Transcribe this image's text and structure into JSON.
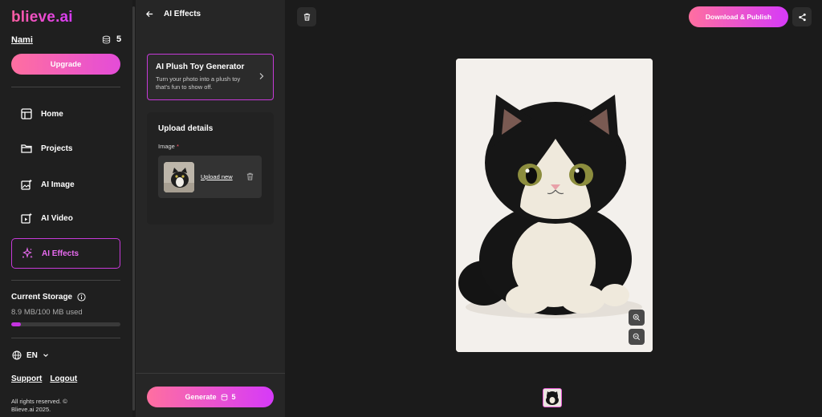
{
  "brand": {
    "logo_text": "blieve.ai",
    "accent": "#d63af9",
    "pink": "#ff6fa0"
  },
  "user": {
    "name": "Nami",
    "credits": "5"
  },
  "sidebar": {
    "upgrade_label": "Upgrade",
    "items": [
      {
        "label": "Home",
        "icon": "home-icon"
      },
      {
        "label": "Projects",
        "icon": "folder-icon"
      },
      {
        "label": "AI Image",
        "icon": "image-sparkle-icon"
      },
      {
        "label": "AI Video",
        "icon": "video-sparkle-icon"
      },
      {
        "label": "AI Effects",
        "icon": "sparkles-icon",
        "active": true
      }
    ],
    "storage": {
      "title": "Current Storage",
      "used_text": "8.9 MB/100 MB used",
      "used_fraction": 0.089
    },
    "language": "EN",
    "support_label": "Support",
    "logout_label": "Logout",
    "copyright": "All rights reserved. © Blieve.ai 2025."
  },
  "panel": {
    "title": "AI Effects",
    "effect": {
      "title": "AI Plush Toy Generator",
      "description": "Turn your photo into a plush toy that's fun to show off."
    },
    "upload": {
      "title": "Upload details",
      "image_label": "Image",
      "required_mark": "*",
      "upload_new_label": "Upload new"
    },
    "generate_label": "Generate",
    "generate_cost": "5"
  },
  "main": {
    "download_label": "Download & Publish"
  }
}
